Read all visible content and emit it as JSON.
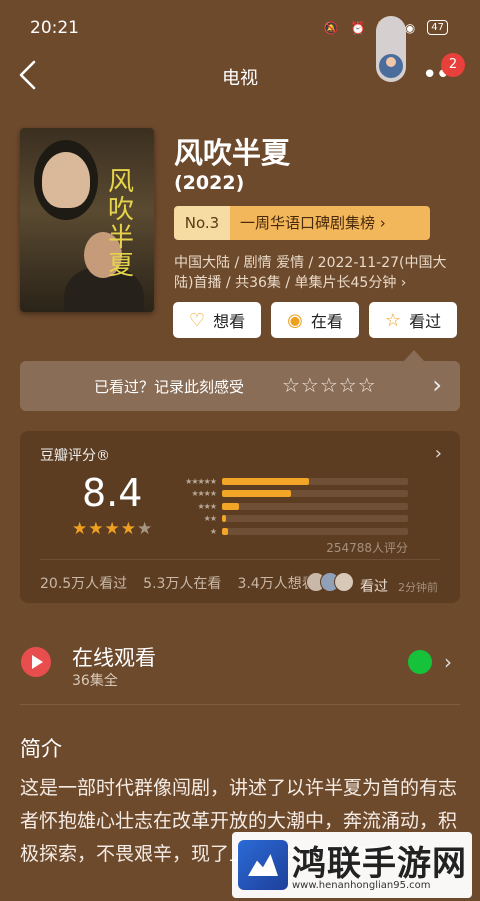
{
  "status_bar": {
    "time": "20:21",
    "battery": "47"
  },
  "nav": {
    "title": "电视",
    "badge_count": "2"
  },
  "movie": {
    "title": "风吹半夏",
    "year": "(2022)",
    "poster_title": "风吹半夏",
    "rank_no": "No.3",
    "rank_name": "一周华语口碑剧集榜",
    "meta": "中国大陆 / 剧情 爱情 / 2022-11-27(中国大陆)首播 / 共36集 / 单集片长45分钟"
  },
  "actions": [
    {
      "label": "想看",
      "icon": "heart-plus-icon"
    },
    {
      "label": "在看",
      "icon": "circle-dot-icon"
    },
    {
      "label": "看过",
      "icon": "star-outline-icon"
    }
  ],
  "feeling": {
    "text": "已看过？记录此刻感受",
    "stars": "☆☆☆☆☆"
  },
  "rating": {
    "title": "豆瓣评分®",
    "score": "8.4",
    "stars_on": "★★★★",
    "stars_off": "★",
    "distribution": [
      0.47,
      0.37,
      0.09,
      0.02,
      0.03
    ],
    "dist_labels": [
      "★★★★★",
      "★★★★",
      "★★★",
      "★★",
      "★"
    ],
    "count": "254788人评分",
    "stats": [
      "20.5万人看过",
      "5.3万人在看",
      "3.4万人想看"
    ],
    "watched_label": "看过",
    "watched_time": "2分钟前"
  },
  "online": {
    "title": "在线观看",
    "sub": "36集全",
    "platform": "iQIYI"
  },
  "intro": {
    "heading": "简介",
    "text": "这是一部时代群像闯剧，讲述了以许半夏为首的有志者怀抱雄心壮志在改革开放的大潮中，奔流涌动，积极探索，不畏艰辛，现了上世纪九十年代中小"
  },
  "watermark": {
    "title": "鸿联手游网",
    "url": "www.henanhonglian95.com"
  },
  "colors": {
    "background": "#6e4a2d",
    "accent": "#f2a526",
    "rank_bg": "#f2b75a"
  }
}
